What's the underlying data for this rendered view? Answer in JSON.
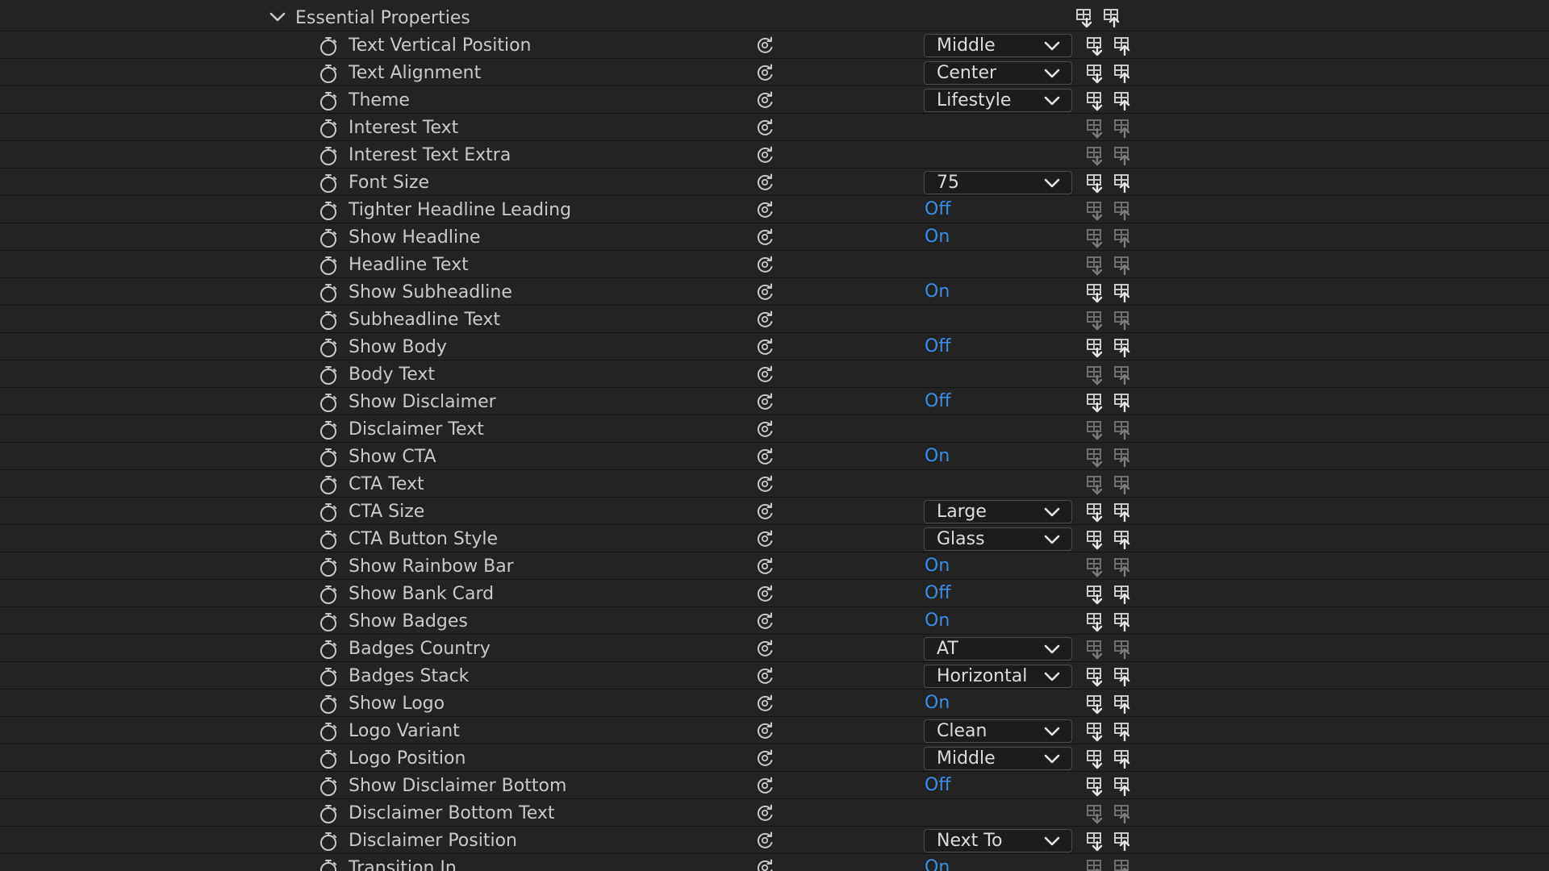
{
  "group": {
    "label": "Essential Properties"
  },
  "properties": [
    {
      "label": "Text Vertical Position",
      "control": "dropdown",
      "value": "Middle",
      "keyframes_active": true
    },
    {
      "label": "Text Alignment",
      "control": "dropdown",
      "value": "Center",
      "keyframes_active": true
    },
    {
      "label": "Theme",
      "control": "dropdown",
      "value": "Lifestyle",
      "keyframes_active": true
    },
    {
      "label": "Interest Text",
      "control": "none",
      "value": "",
      "keyframes_active": false
    },
    {
      "label": "Interest Text Extra",
      "control": "none",
      "value": "",
      "keyframes_active": false
    },
    {
      "label": "Font Size",
      "control": "dropdown",
      "value": "75",
      "keyframes_active": true
    },
    {
      "label": "Tighter Headline Leading",
      "control": "toggle",
      "value": "Off",
      "keyframes_active": false
    },
    {
      "label": "Show Headline",
      "control": "toggle",
      "value": "On",
      "keyframes_active": false
    },
    {
      "label": "Headline Text",
      "control": "none",
      "value": "",
      "keyframes_active": false
    },
    {
      "label": "Show Subheadline",
      "control": "toggle",
      "value": "On",
      "keyframes_active": true
    },
    {
      "label": "Subheadline Text",
      "control": "none",
      "value": "",
      "keyframes_active": false
    },
    {
      "label": "Show Body",
      "control": "toggle",
      "value": "Off",
      "keyframes_active": true
    },
    {
      "label": "Body Text",
      "control": "none",
      "value": "",
      "keyframes_active": false
    },
    {
      "label": "Show Disclaimer",
      "control": "toggle",
      "value": "Off",
      "keyframes_active": true
    },
    {
      "label": "Disclaimer Text",
      "control": "none",
      "value": "",
      "keyframes_active": false
    },
    {
      "label": "Show CTA",
      "control": "toggle",
      "value": "On",
      "keyframes_active": false
    },
    {
      "label": "CTA Text",
      "control": "none",
      "value": "",
      "keyframes_active": false
    },
    {
      "label": "CTA Size",
      "control": "dropdown",
      "value": "Large",
      "keyframes_active": true
    },
    {
      "label": "CTA Button Style",
      "control": "dropdown",
      "value": "Glass",
      "keyframes_active": true
    },
    {
      "label": "Show Rainbow Bar",
      "control": "toggle",
      "value": "On",
      "keyframes_active": false
    },
    {
      "label": "Show Bank Card",
      "control": "toggle",
      "value": "Off",
      "keyframes_active": true
    },
    {
      "label": "Show Badges",
      "control": "toggle",
      "value": "On",
      "keyframes_active": true
    },
    {
      "label": "Badges Country",
      "control": "dropdown",
      "value": "AT",
      "keyframes_active": false
    },
    {
      "label": "Badges Stack",
      "control": "dropdown",
      "value": "Horizontal",
      "keyframes_active": true
    },
    {
      "label": "Show Logo",
      "control": "toggle",
      "value": "On",
      "keyframes_active": true
    },
    {
      "label": "Logo Variant",
      "control": "dropdown",
      "value": "Clean",
      "keyframes_active": true
    },
    {
      "label": "Logo Position",
      "control": "dropdown",
      "value": "Middle",
      "keyframes_active": true
    },
    {
      "label": "Show Disclaimer Bottom",
      "control": "toggle",
      "value": "Off",
      "keyframes_active": true
    },
    {
      "label": "Disclaimer Bottom Text",
      "control": "none",
      "value": "",
      "keyframes_active": false
    },
    {
      "label": "Disclaimer Position",
      "control": "dropdown",
      "value": "Next To",
      "keyframes_active": true
    },
    {
      "label": "Transition In",
      "control": "toggle",
      "value": "On",
      "keyframes_active": false
    }
  ],
  "colors": {
    "background": "#232323",
    "row_divider": "#141414",
    "label_text": "#c9c9c9",
    "toggle_value": "#3a8ee6",
    "dropdown_bg": "#1c1c1c",
    "dropdown_border": "#4a4a4a"
  },
  "icons": {
    "group_toggle": "chevron-down-icon",
    "stopwatch": "stopwatch-icon",
    "reset": "reset-parameter-icon",
    "prev_keyframe": "go-to-previous-keyframe-icon",
    "next_keyframe": "go-to-next-keyframe-icon",
    "dropdown": "chevron-down-icon"
  }
}
